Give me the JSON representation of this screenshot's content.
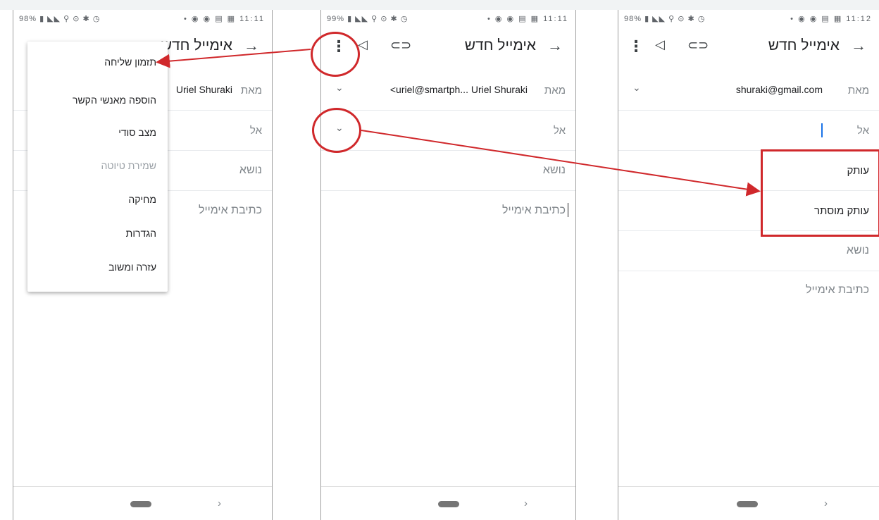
{
  "panel1": {
    "status_left": "98% ▮ ◣◣ ⚲ ⊙ ✱ ◷",
    "status_right": "• ◉ ◉ ▤ ▦ 11:11",
    "back_icon": "→",
    "title": "אימייל חדש",
    "from_label": "מאת",
    "from_value": "Uriel Shuraki",
    "to_label": "אל",
    "subject_placeholder": "נושא",
    "body_placeholder": "כתיבת אימייל",
    "menu": {
      "items": [
        {
          "label": "תזמון שליחה",
          "enabled": true
        },
        {
          "label": "הוספה מאנשי הקשר",
          "enabled": true
        },
        {
          "label": "מצב סודי",
          "enabled": true
        },
        {
          "label": "שמירת טיוטה",
          "enabled": false
        },
        {
          "label": "מחיקה",
          "enabled": true
        },
        {
          "label": "הגדרות",
          "enabled": true
        },
        {
          "label": "עזרה ומשוב",
          "enabled": true
        }
      ]
    },
    "nav_chevron": "›"
  },
  "panel2": {
    "status_left": "99% ▮ ◣◣ ⚲ ⊙ ✱ ◷",
    "status_right": "• ◉ ◉ ▤ ▦ 11:11",
    "back_icon": "→",
    "title": "אימייל חדש",
    "more_icon": "⋮",
    "send_icon": "◁",
    "attach_icon": "⊂⊃",
    "from_label": "מאת",
    "from_value": "<uriel@smartph... Uriel Shuraki",
    "from_chevron": "⌄",
    "to_label": "אל",
    "to_chevron": "⌄",
    "subject_placeholder": "נושא",
    "body_placeholder": "כתיבת אימייל",
    "nav_chevron": "›"
  },
  "panel3": {
    "status_left": "98% ▮ ◣◣ ⚲ ⊙ ✱ ◷",
    "status_right": "• ◉ ◉ ▤ ▦ 11:12",
    "back_icon": "→",
    "title": "אימייל חדש",
    "more_icon": "⋮",
    "send_icon": "◁",
    "attach_icon": "⊂⊃",
    "from_label": "מאת",
    "from_value": "shuraki@gmail.com",
    "from_chevron": "⌄",
    "to_label": "אל",
    "cc_label": "עותק",
    "bcc_label": "עותק מוסתר",
    "subject_placeholder": "נושא",
    "body_placeholder": "כתיבת אימייל",
    "nav_chevron": "›"
  },
  "colors": {
    "annotation_red": "#d0282b",
    "cursor_blue": "#1a73e8"
  }
}
